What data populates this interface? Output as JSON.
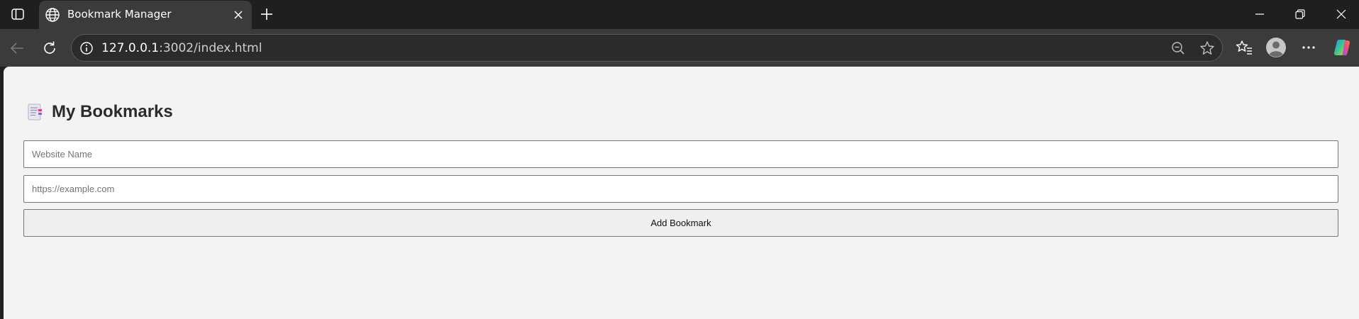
{
  "browser": {
    "tab": {
      "title": "Bookmark Manager",
      "favicon": "globe-icon"
    },
    "address": {
      "host": "127.0.0.1",
      "rest": ":3002/index.html"
    },
    "icons": {
      "sidebar": "sidebar-toggle-icon",
      "close_tab": "close-icon",
      "new_tab": "plus-icon",
      "minimize": "minimize-icon",
      "restore": "restore-icon",
      "close_window": "close-icon",
      "back": "back-arrow-icon",
      "refresh": "refresh-icon",
      "site_info": "info-icon",
      "zoom": "zoom-out-icon",
      "favorite": "star-icon",
      "favorites": "favorites-icon",
      "profile": "avatar",
      "more": "more-icon",
      "copilot": "copilot-icon"
    }
  },
  "page": {
    "title": "My Bookmarks",
    "title_emoji": "bookmark-tabs-icon",
    "name_input": {
      "placeholder": "Website Name",
      "value": ""
    },
    "url_input": {
      "placeholder": "https://example.com",
      "value": ""
    },
    "add_button": "Add Bookmark"
  },
  "colors": {
    "chrome_dark": "#1f1f1f",
    "toolbar": "#3b3b3b",
    "page_background": "#f3f3f3",
    "text": "#2b2b2b"
  }
}
